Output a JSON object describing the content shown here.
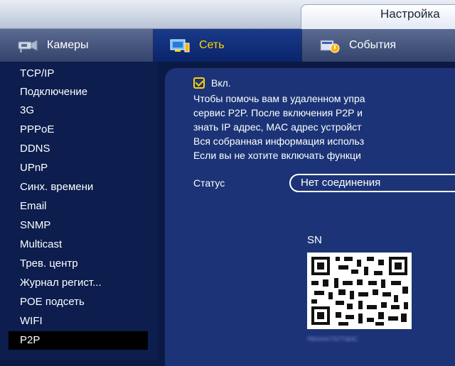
{
  "window": {
    "title": "Настройка"
  },
  "tabs": [
    {
      "label": "Камеры",
      "icon": "camera-icon"
    },
    {
      "label": "Сеть",
      "icon": "network-icon",
      "active": true
    },
    {
      "label": "События",
      "icon": "events-icon"
    }
  ],
  "sidebar": {
    "items": [
      {
        "label": "TCP/IP"
      },
      {
        "label": "Подключение"
      },
      {
        "label": "3G"
      },
      {
        "label": "PPPoE"
      },
      {
        "label": "DDNS"
      },
      {
        "label": "UPnP"
      },
      {
        "label": "Синх. времени"
      },
      {
        "label": "Email"
      },
      {
        "label": "SNMP"
      },
      {
        "label": "Multicast"
      },
      {
        "label": "Трев. центр"
      },
      {
        "label": "Журнал регист..."
      },
      {
        "label": "POE подсеть"
      },
      {
        "label": "WIFI"
      },
      {
        "label": "P2P",
        "active": true
      }
    ]
  },
  "p2p": {
    "enable_label": "Вкл.",
    "enabled": true,
    "description": [
      "Чтобы помочь вам в удаленном упра",
      "сервис P2P. После включения P2P и",
      "знать IP адрес, МАС адрес устройст",
      "Вся собранная информация использ",
      "Если вы не хотите включать функци"
    ],
    "status_label": "Статус",
    "status_value": "Нет соединения",
    "sn_label": "SN",
    "sn_value": "PBAAAA7TA7TSB4C"
  },
  "colors": {
    "accent": "#ffd400",
    "panel": "#1c3477",
    "sidebar": "#0c1d4e",
    "active_item": "#000000"
  }
}
